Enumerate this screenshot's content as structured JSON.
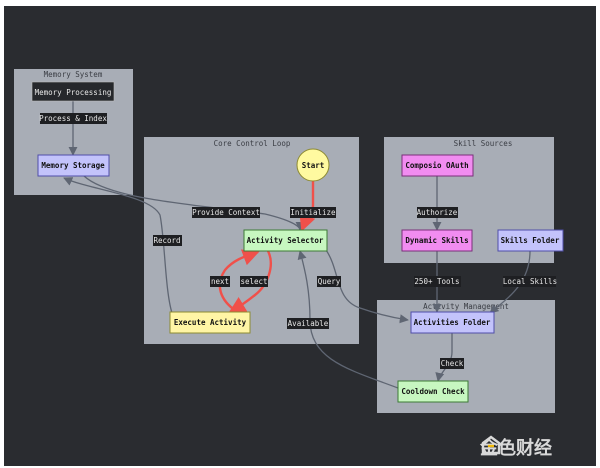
{
  "clusters": {
    "memory": "Memory System",
    "core": "Core Control Loop",
    "skills": "Skill Sources",
    "activity": "Activity Management"
  },
  "nodes": {
    "memory_processing": "Memory Processing",
    "memory_storage": "Memory Storage",
    "start": "Start",
    "activity_selector": "Activity Selector",
    "execute_activity": "Execute Activity",
    "composio_oauth": "Composio OAuth",
    "dynamic_skills": "Dynamic Skills",
    "skills_folder": "Skills Folder",
    "activities_folder": "Activities Folder",
    "cooldown_check": "Cooldown Check"
  },
  "edges": {
    "process_index": "Process & Index",
    "provide_context": "Provide Context",
    "initialize": "Initialize",
    "record": "Record",
    "next": "next",
    "select": "select",
    "query": "Query",
    "available": "Available",
    "authorize": "Authorize",
    "tools": "250+ Tools",
    "local_skills": "Local Skills",
    "check": "Check"
  },
  "watermark": "金色财经",
  "colors": {
    "background": "#2a2c30",
    "cluster": "#a8adb6",
    "memory_node": "#c3c3fb",
    "start_node": "#fffaa0",
    "selector_node": "#c7f7c0",
    "execute_node": "#fff5a5",
    "pink_node": "#f18cf0",
    "edge": "#5f6673",
    "loop_edge": "#f0504a"
  }
}
